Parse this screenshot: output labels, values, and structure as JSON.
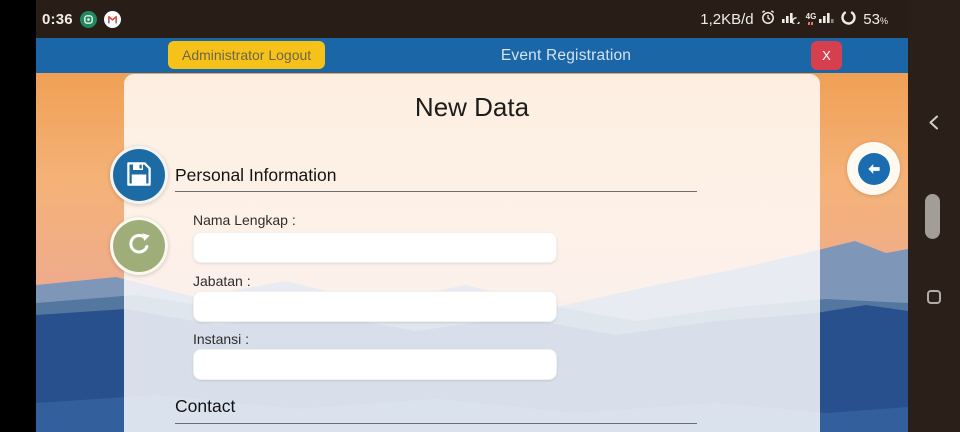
{
  "status_bar": {
    "time": "0:36",
    "data_rate": "1,2KB/d",
    "network_label": "4G",
    "battery_percent": "53",
    "percent_sign": "%",
    "icons": [
      "green-app-icon",
      "gmail-icon",
      "alarm-icon",
      "signal-bars-icon",
      "crescent-icon",
      "signal-bars-4g-icon",
      "battery-ring-icon"
    ]
  },
  "nav_rail": {
    "icons": [
      "chevron-back-icon",
      "home-pill",
      "recents-square"
    ]
  },
  "header": {
    "logout_label": "Administrator Logout",
    "title": "Event Registration",
    "close_label": "X"
  },
  "page": {
    "title": "New Data"
  },
  "sections": [
    {
      "heading": "Personal Information",
      "fields": [
        {
          "label": "Nama Lengkap :",
          "value": ""
        },
        {
          "label": "Jabatan :",
          "value": ""
        },
        {
          "label": "Instansi :",
          "value": ""
        }
      ]
    },
    {
      "heading": "Contact",
      "fields": []
    }
  ],
  "fabs": {
    "save": "floppy-disk-icon",
    "refresh": "refresh-icon",
    "back": "back-arrow-icon"
  },
  "colors": {
    "header_blue": "#1b66a7",
    "logout_yellow": "#f6c21a",
    "close_red": "#d6404e",
    "save_blue": "#1d6ba5",
    "refresh_green": "#9fae78",
    "back_blue": "#1b6cb0",
    "statusbar_dark": "#281d17",
    "mountain_deep_blue": "#27508d"
  }
}
